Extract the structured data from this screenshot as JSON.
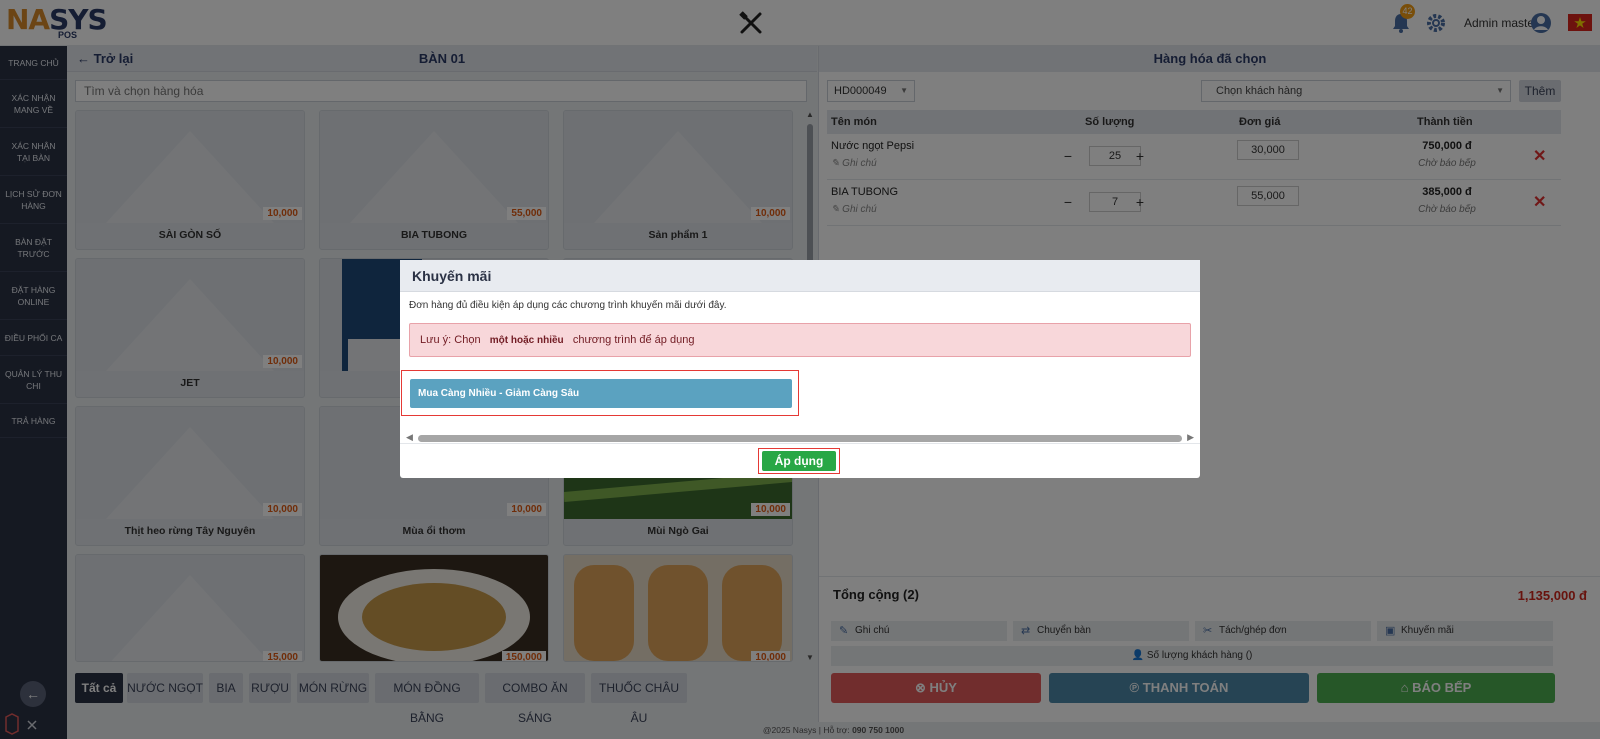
{
  "header": {
    "logo_left": "NA",
    "logo_mid": "S",
    "logo_right": "YS",
    "logo_sub": "POS",
    "notification_count": "42",
    "admin_name": "Admin master"
  },
  "sidebar": {
    "items": [
      {
        "label": "TRANG CHỦ"
      },
      {
        "label": "XÁC NHẬN MANG VỀ"
      },
      {
        "label": "XÁC NHẬN TẠI BÀN"
      },
      {
        "label": "LỊCH SỬ ĐƠN HÀNG"
      },
      {
        "label": "BÀN ĐẶT TRƯỚC"
      },
      {
        "label": "ĐẶT HÀNG ONLINE"
      },
      {
        "label": "ĐIỀU PHỐI CA"
      },
      {
        "label": "QUẢN LÝ THU CHI"
      },
      {
        "label": "TRẢ HÀNG"
      }
    ]
  },
  "left_panel": {
    "back_label": "← Trở lại",
    "table_name": "BÀN 01",
    "search_placeholder": "Tìm và chọn hàng hóa",
    "products": [
      {
        "name": "SÀI GÒN SỐ",
        "price": "10,000"
      },
      {
        "name": "BIA TUBONG",
        "price": "55,000"
      },
      {
        "name": "Sản phẩm 1",
        "price": "10,000"
      },
      {
        "name": "JET",
        "price": "10,000"
      },
      {
        "name": "",
        "price": ""
      },
      {
        "name": "",
        "price": ""
      },
      {
        "name": "Thịt heo rừng Tây Nguyên",
        "price": "10,000"
      },
      {
        "name": "Mùa ổi thơm",
        "price": "10,000"
      },
      {
        "name": "Mùi Ngò Gai",
        "price": "10,000"
      },
      {
        "name": "",
        "price": "15,000"
      },
      {
        "name": "",
        "price": "150,000"
      },
      {
        "name": "",
        "price": "10,000"
      }
    ],
    "categories": [
      "Tất cả",
      "NƯỚC NGỌT",
      "BIA",
      "RƯỢU",
      "MÓN RỪNG",
      "MÓN ĐỒNG BẰNG",
      "COMBO ĂN SÁNG",
      "THUỐC CHÂU ÂU"
    ]
  },
  "right_panel": {
    "title": "Hàng hóa đã chọn",
    "order_code": "HD000049",
    "customer_placeholder": "Chọn khách hàng",
    "add_label": "Thêm",
    "columns": {
      "name": "Tên món",
      "qty": "Số lượng",
      "unit_price": "Đơn giá",
      "total": "Thành tiền"
    },
    "items": [
      {
        "name": "Nước ngọt Pepsi",
        "note": "Ghi chú",
        "qty": "25",
        "unit_price": "30,000",
        "total": "750,000 đ",
        "status": "Chờ báo bếp"
      },
      {
        "name": "BIA TUBONG",
        "note": "Ghi chú",
        "qty": "7",
        "unit_price": "55,000",
        "total": "385,000 đ",
        "status": "Chờ báo bếp"
      }
    ],
    "sum_label": "Tổng cộng (2)",
    "sum_value": "1,135,000 đ",
    "actions": [
      "Ghi chú",
      "Chuyển bàn",
      "Tách/ghép đơn",
      "Khuyến mãi"
    ],
    "guest_count_label": "Số lượng khách hàng ()",
    "cancel_label": "HỦY",
    "pay_label": "THANH TOÁN",
    "kitchen_label": "BÁO BẾP"
  },
  "footer": {
    "text_prefix": "@2025 Nasys | Hỗ trợ: ",
    "phone": "090 750 1000"
  },
  "modal": {
    "title": "Khuyến mãi",
    "description": "Đơn hàng đủ điều kiện áp dụng các chương trình khuyến mãi dưới đây.",
    "alert_prefix": "Lưu ý: Chọn",
    "alert_strong": "một hoặc nhiều",
    "alert_suffix": "chương trình để áp dụng",
    "promotion": "Mua Càng Nhiều - Giảm Càng Sâu",
    "apply_label": "Áp dụng"
  },
  "colors": {
    "sidebar_bg": "#2b3245",
    "price_orange": "#e05a12",
    "cancel_red": "#e35b5b",
    "pay_blue": "#4d88a9",
    "kitchen_green": "#4caf50",
    "apply_green": "#28a745",
    "promo_blue": "#5ba2c0"
  }
}
